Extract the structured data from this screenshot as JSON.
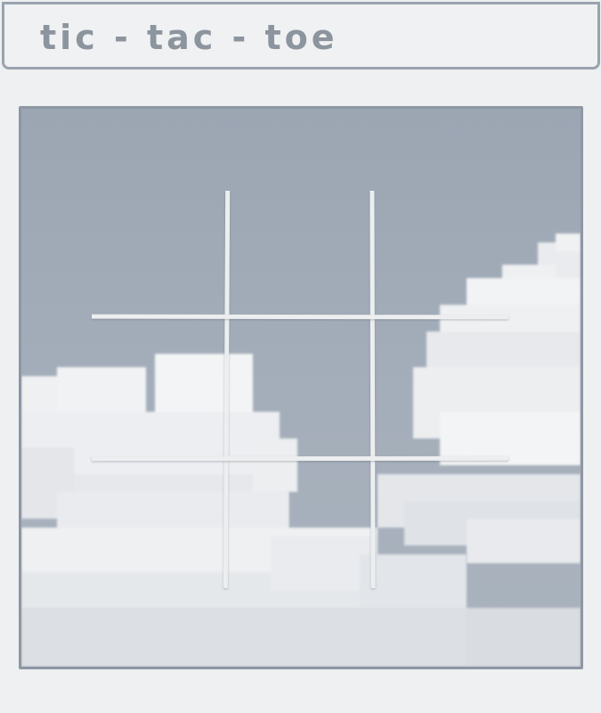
{
  "header": {
    "title": "tic - tac - toe"
  },
  "board": {
    "rows": 3,
    "cols": 3,
    "cells": [
      "",
      "",
      "",
      "",
      "",
      "",
      "",
      "",
      ""
    ],
    "grid_line_color": "#eceeef",
    "sky_color": "#9ca6b3",
    "cloud_color": "#f4f5f6"
  }
}
